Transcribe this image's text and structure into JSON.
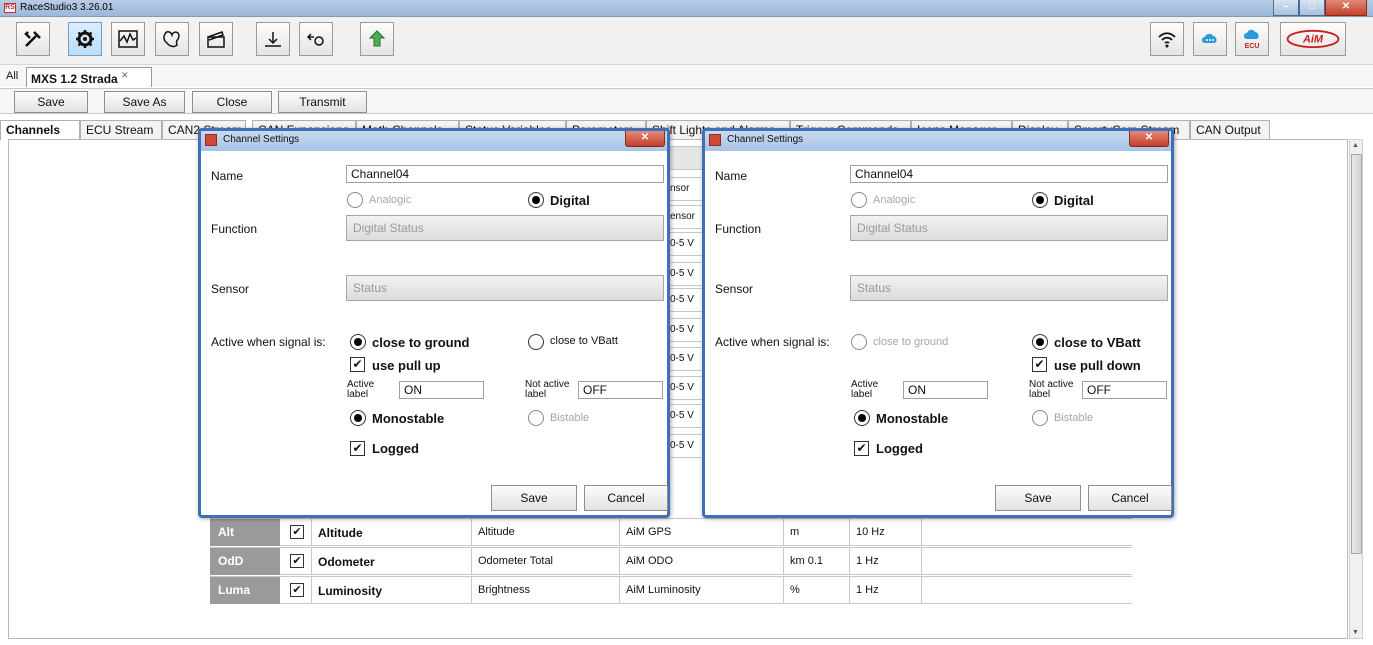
{
  "window": {
    "title": "RaceStudio3 3.26.01",
    "app_icon": "racestudio-icon"
  },
  "toolbar": {
    "left_icons": [
      "wrench-icon",
      "gear-icon",
      "waveform-icon",
      "track-map-icon",
      "clapper-icon",
      "usb-install-icon",
      "add-device-icon",
      "transfer-icon"
    ],
    "right_icons": [
      "wifi-icon",
      "cloud-icon",
      "ecu-cloud-icon",
      "aim-logo"
    ],
    "ecu_label": "ECU",
    "aim_label": "AiM"
  },
  "config": {
    "all_label": "All",
    "tab_label": "MXS 1.2 Strada",
    "tab_close": "✕"
  },
  "actions": {
    "save": "Save",
    "save_as": "Save As",
    "close": "Close",
    "transmit": "Transmit"
  },
  "subtabs": [
    "Channels",
    "ECU Stream",
    "CAN2 Stream",
    "CAN Expansions",
    "Math Channels",
    "Status Variables",
    "Parameters",
    "Shift Lights and Alarms",
    "Trigger Commands",
    "Icons Manager",
    "Display",
    "SmartyCam Stream",
    "CAN Output"
  ],
  "stub_column": [
    "",
    "nsor",
    "ensor",
    "0-5 V",
    "0-5 V",
    "0-5 V",
    "0-5 V",
    "0-5 V",
    "0-5 V",
    "0-5 V",
    "0-5 V"
  ],
  "channels": [
    {
      "id": "Alt",
      "name": "Altitude",
      "function": "Altitude",
      "sensor": "AiM GPS",
      "unit": "m",
      "freq": "10 Hz"
    },
    {
      "id": "OdD",
      "name": "Odometer",
      "function": "Odometer Total",
      "sensor": "AiM ODO",
      "unit": "km 0.1",
      "freq": "1 Hz"
    },
    {
      "id": "Luma",
      "name": "Luminosity",
      "function": "Brightness",
      "sensor": "AiM Luminosity",
      "unit": "%",
      "freq": "1 Hz"
    }
  ],
  "dialogs": [
    {
      "title": "Channel Settings",
      "close": "✕",
      "name_label": "Name",
      "name_value": "Channel04",
      "analogic": "Analogic",
      "digital": "Digital",
      "function_label": "Function",
      "function_value": "Digital Status",
      "sensor_label": "Sensor",
      "sensor_value": "Status",
      "active_label": "Active when signal is:",
      "close_ground": "close to ground",
      "close_vbatt": "close to VBatt",
      "pull_label": "use pull up",
      "active_lbl_1": "Active",
      "active_lbl_2": "label",
      "active_value": "ON",
      "notactive_lbl_1": "Not active",
      "notactive_lbl_2": "label",
      "notactive_value": "OFF",
      "monostable": "Monostable",
      "bistable": "Bistable",
      "logged": "Logged",
      "save": "Save",
      "cancel": "Cancel"
    },
    {
      "title": "Channel Settings",
      "close": "✕",
      "name_label": "Name",
      "name_value": "Channel04",
      "analogic": "Analogic",
      "digital": "Digital",
      "function_label": "Function",
      "function_value": "Digital Status",
      "sensor_label": "Sensor",
      "sensor_value": "Status",
      "active_label": "Active when signal is:",
      "close_ground": "close to ground",
      "close_vbatt": "close to VBatt",
      "pull_label": "use pull down",
      "active_lbl_1": "Active",
      "active_lbl_2": "label",
      "active_value": "ON",
      "notactive_lbl_1": "Not active",
      "notactive_lbl_2": "label",
      "notactive_value": "OFF",
      "monostable": "Monostable",
      "bistable": "Bistable",
      "logged": "Logged",
      "save": "Save",
      "cancel": "Cancel"
    }
  ]
}
